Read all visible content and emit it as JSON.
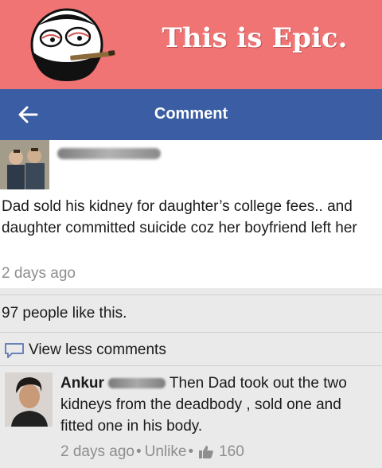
{
  "banner": {
    "title": "This is Epic."
  },
  "appbar": {
    "title": "Comment",
    "back_icon": "back-arrow-icon"
  },
  "post": {
    "text": "Dad sold his kidney for daughter’s college fees.. and daughter committed suicide coz her boyfriend left her",
    "time": "2 days ago"
  },
  "likes_text": "97 people like this.",
  "view_less": {
    "label": "View less comments",
    "icon": "comment-bubble-icon"
  },
  "comment": {
    "author": "Ankur",
    "text": "Then Dad took out the two kidneys from the deadbody , sold one and fitted one in his body.",
    "time": "2 days ago",
    "dot": "•",
    "unlike_label": "Unlike",
    "like_count": "160",
    "like_icon": "thumbs-up-icon"
  },
  "colors": {
    "banner_bg": "#f17474",
    "appbar_bg": "#3a5da3",
    "secondary_text": "#8e8e8e"
  }
}
